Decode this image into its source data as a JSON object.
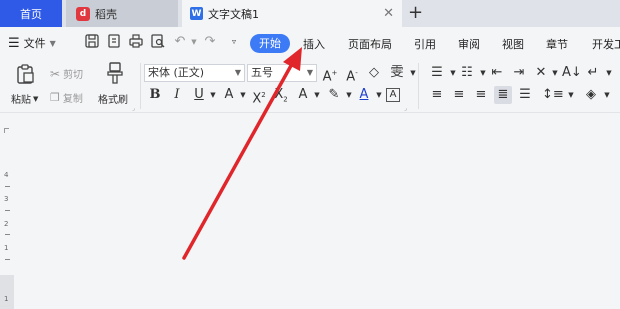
{
  "tabs": {
    "home": "首页",
    "daoke": "稻壳",
    "doc": "文字文稿1",
    "doc_logo": "W",
    "daoke_logo": "d"
  },
  "menu": {
    "file": "文件",
    "items": [
      "开始",
      "插入",
      "页面布局",
      "引用",
      "审阅",
      "视图",
      "章节",
      "开发工"
    ]
  },
  "ribbon": {
    "paste": "粘贴",
    "cut": "剪切",
    "copy": "复制",
    "format_painter": "格式刷",
    "font_name": "宋体 (正文)",
    "font_size": "五号"
  },
  "ruler": {
    "numbers": [
      "4",
      "3",
      "2",
      "1",
      "1"
    ]
  },
  "annotation_color": "#e0262a"
}
